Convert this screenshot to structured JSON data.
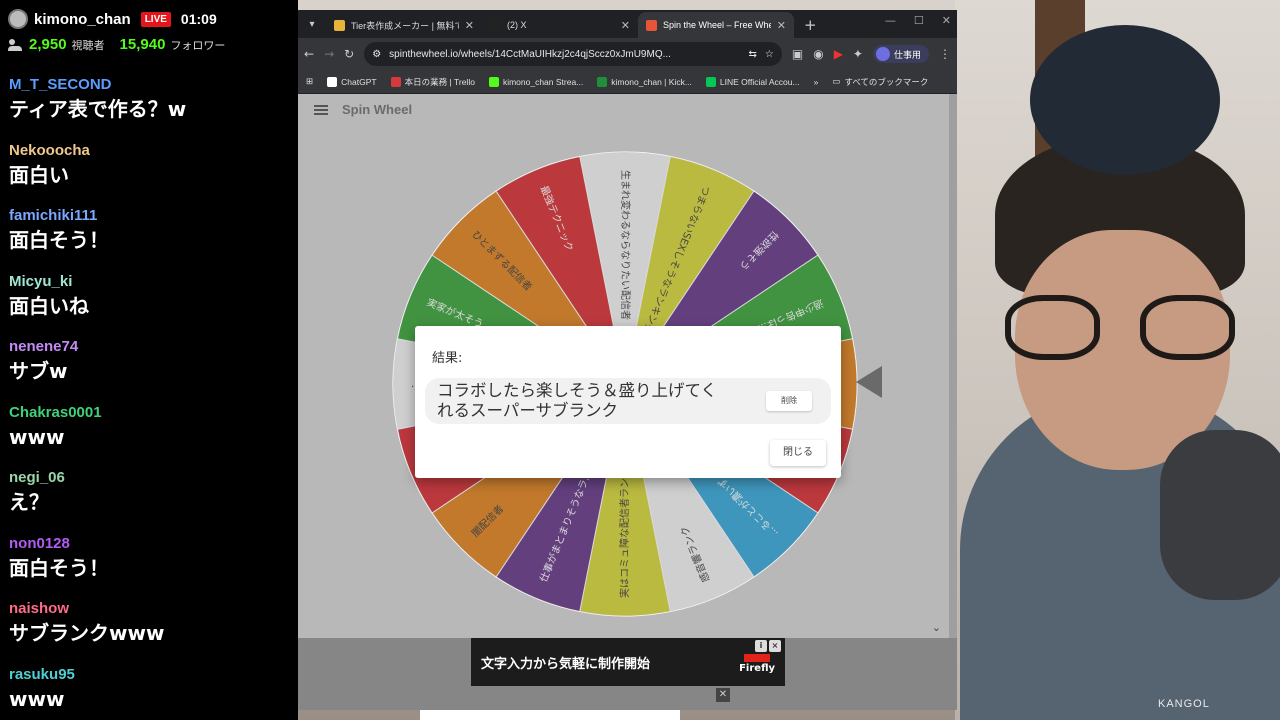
{
  "stream": {
    "channel": "kimono_chan",
    "live_badge": "LIVE",
    "elapsed": "01:09",
    "viewers": "2,950",
    "viewers_label": "視聴者",
    "followers": "15,940",
    "followers_label": "フォロワー"
  },
  "chat": [
    {
      "user": "M_T_SECOND",
      "color": "#5b9dff",
      "text": "ティア表で作る？w"
    },
    {
      "user": "Nekooocha",
      "color": "#f0c98a",
      "text": "面白い"
    },
    {
      "user": "famichiki111",
      "color": "#7aa7ff",
      "text": "面白そう！"
    },
    {
      "user": "Micyu_ki",
      "color": "#9ee7d5",
      "text": "面白いね"
    },
    {
      "user": "nenene74",
      "color": "#c58cf7",
      "text": "サブw"
    },
    {
      "user": "Chakras0001",
      "color": "#3fd17a",
      "text": "www"
    },
    {
      "user": "negi_06",
      "color": "#9ad6a8",
      "text": "え？"
    },
    {
      "user": "non0128",
      "color": "#b15cf2",
      "text": "面白そう！"
    },
    {
      "user": "naishow",
      "color": "#ff6b8a",
      "text": "サブランクwww"
    },
    {
      "user": "rasuku95",
      "color": "#4fcfd1",
      "text": "www"
    }
  ],
  "browser": {
    "tabs": [
      {
        "title": "Tier表作成メーカー | 無料でティ",
        "fav_color": "#e8b53a",
        "active": false
      },
      {
        "title": "(2) X",
        "fav_color": "#222222",
        "active": false
      },
      {
        "title": "Spin the Wheel – Free Whe",
        "fav_color": "#e6553a",
        "active": true
      }
    ],
    "url": "spinthewheel.io/wheels/14CctMaUIHkzj2c4qjSccz0xJmU9MQ...",
    "profile": "仕事用",
    "bookmarks": [
      {
        "label": "ChatGPT",
        "color": "#ffffff"
      },
      {
        "label": "本日の業務 | Trello",
        "color": "#d63a3a"
      },
      {
        "label": "kimono_chan Strea...",
        "color": "#53fc18"
      },
      {
        "label": "kimono_chan | Kick...",
        "color": "#1f8f3a"
      },
      {
        "label": "LINE Official Accou...",
        "color": "#06c755"
      }
    ],
    "bookmarks_more": "»",
    "all_bookmarks": "すべてのブックマーク"
  },
  "app": {
    "logo": "Spin Wheel"
  },
  "wheel": {
    "segments": [
      {
        "label": "生まれ変わるならなりたい配信者",
        "color": "#f2f2f2"
      },
      {
        "label": "つまらないSEXしそうなランキング",
        "color": "#d4d32c"
      },
      {
        "label": "性欲強そう",
        "color": "#5c2a82"
      },
      {
        "label": "過少申告っぽ...",
        "color": "#2d9f2d"
      },
      {
        "label": "",
        "color": "#e07a10"
      },
      {
        "label": "",
        "color": "#d62027"
      },
      {
        "label": "...ることが濃いず...",
        "color": "#2aa3d8"
      },
      {
        "label": "感音響ランク",
        "color": "#f2f2f2"
      },
      {
        "label": "実はコミュ障な配信者ランク",
        "color": "#d4d32c"
      },
      {
        "label": "仕事がまとまりそうなラ...",
        "color": "#5c2a82"
      },
      {
        "label": "闇配信者",
        "color": "#e07a10"
      },
      {
        "label": "",
        "color": "#d62027"
      },
      {
        "label": "...ロ",
        "color": "#f2f2f2"
      },
      {
        "label": "実家が太そう",
        "color": "#2d9f2d"
      },
      {
        "label": "ひとまずる配信者",
        "color": "#e07a10"
      },
      {
        "label": "最強テクニック",
        "color": "#d62027"
      }
    ]
  },
  "modal": {
    "title": "結果:",
    "result": "コラボしたら楽しそう＆盛り上げてくれるスーパーサブランク",
    "delete_label": "削除",
    "close_label": "閉じる"
  },
  "ad": {
    "text": "文字入力から気軽に制作開始",
    "brand": "Firefly"
  },
  "overlay": {
    "shirt_logo": "KANGOL"
  }
}
